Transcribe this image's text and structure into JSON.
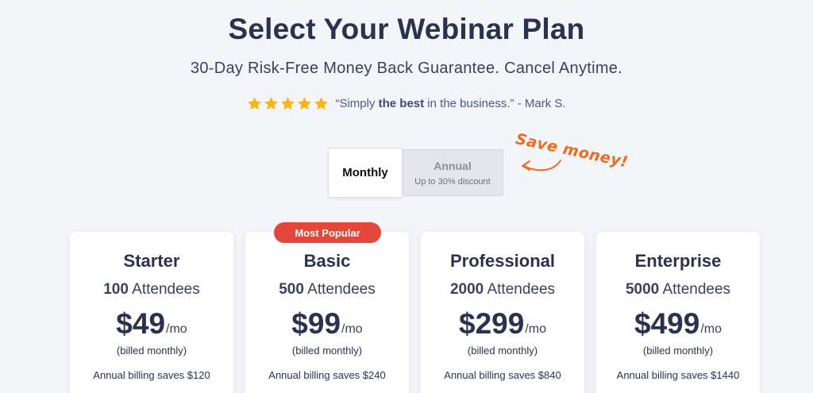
{
  "header": {
    "title": "Select Your Webinar Plan",
    "subtitle": "30-Day Risk-Free Money Back Guarantee. Cancel Anytime."
  },
  "testimonial": {
    "stars": 5,
    "star_color": "#f5b51c",
    "quote_prefix": "“Simply ",
    "quote_bold": "the best",
    "quote_suffix": " in the business.” - Mark S."
  },
  "billing_toggle": {
    "monthly_label": "Monthly",
    "annual_label": "Annual",
    "annual_sub": "Up to 30% discount",
    "selected": "Monthly"
  },
  "promo": {
    "text": "Save money!",
    "color": "#ef6a1d"
  },
  "badge": {
    "text": "Most Popular",
    "color": "#e2473a"
  },
  "plans": [
    {
      "name": "Starter",
      "attendees_count": "100",
      "attendees_label": "Attendees",
      "price": "$49",
      "period": "/mo",
      "billed": "(billed monthly)",
      "saves": "Annual billing saves $120"
    },
    {
      "name": "Basic",
      "attendees_count": "500",
      "attendees_label": "Attendees",
      "price": "$99",
      "period": "/mo",
      "billed": "(billed monthly)",
      "saves": "Annual billing saves $240"
    },
    {
      "name": "Professional",
      "attendees_count": "2000",
      "attendees_label": "Attendees",
      "price": "$299",
      "period": "/mo",
      "billed": "(billed monthly)",
      "saves": "Annual billing saves $840"
    },
    {
      "name": "Enterprise",
      "attendees_count": "5000",
      "attendees_label": "Attendees",
      "price": "$499",
      "period": "/mo",
      "billed": "(billed monthly)",
      "saves": "Annual billing saves $1440"
    }
  ]
}
